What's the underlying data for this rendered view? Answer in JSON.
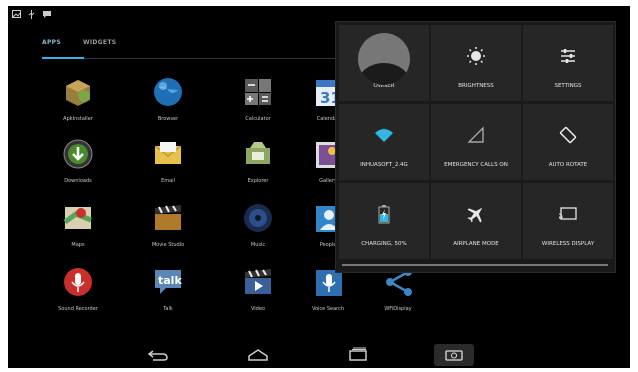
{
  "tabs": [
    "APPS",
    "WIDGETS"
  ],
  "apps": [
    {
      "label": "ApkInstaller",
      "icon": "apk-installer-icon",
      "color": "#7aa646"
    },
    {
      "label": "Browser",
      "icon": "browser-globe-icon",
      "color": "#1e6fb5"
    },
    {
      "label": "Calculator",
      "icon": "calculator-icon",
      "color": "#555555"
    },
    {
      "label": "Calendar",
      "icon": "calendar-icon",
      "color": "#3a78c3"
    },
    {
      "label": "Downloads",
      "icon": "downloads-icon",
      "color": "#4a8a2f"
    },
    {
      "label": "Email",
      "icon": "email-icon",
      "color": "#e8c14d"
    },
    {
      "label": "Explorer",
      "icon": "explorer-icon",
      "color": "#8da763"
    },
    {
      "label": "Gallery",
      "icon": "gallery-icon",
      "color": "#7b4f96"
    },
    {
      "label": "Maps",
      "icon": "maps-icon",
      "color": "#58a35a"
    },
    {
      "label": "Movie Studio",
      "icon": "movie-studio-icon",
      "color": "#b07a2a"
    },
    {
      "label": "Music",
      "icon": "music-icon",
      "color": "#2c4f8c"
    },
    {
      "label": "People",
      "icon": "people-icon",
      "color": "#2f86c8"
    },
    {
      "label": "Sound Recorder",
      "icon": "sound-recorder-icon",
      "color": "#c9302c"
    },
    {
      "label": "Talk",
      "icon": "talk-icon",
      "color": "#5c86b6"
    },
    {
      "label": "Video",
      "icon": "video-icon",
      "color": "#3a5f99"
    },
    {
      "label": "Voice Search",
      "icon": "voice-search-icon",
      "color": "#2d6fb0"
    },
    {
      "label": "WFiDisplay",
      "icon": "wifi-display-share-icon",
      "color": "#3a86c6"
    }
  ],
  "quick_settings": [
    {
      "label": "OWNER",
      "icon": "owner-avatar-icon"
    },
    {
      "label": "BRIGHTNESS",
      "icon": "brightness-icon"
    },
    {
      "label": "SETTINGS",
      "icon": "settings-sliders-icon"
    },
    {
      "label": "INHUASOFT_2.4G",
      "icon": "wifi-icon"
    },
    {
      "label": "EMERGENCY CALLS ON",
      "icon": "signal-icon"
    },
    {
      "label": "AUTO ROTATE",
      "icon": "rotate-icon"
    },
    {
      "label": "CHARGING, 50%",
      "icon": "battery-charging-icon"
    },
    {
      "label": "AIRPLANE MODE",
      "icon": "airplane-icon"
    },
    {
      "label": "WIRELESS DISPLAY",
      "icon": "wireless-display-icon"
    }
  ],
  "nav": [
    "back-icon",
    "home-icon",
    "recent-apps-icon",
    "screenshot-icon"
  ],
  "colors": {
    "accent": "#33b5e5",
    "panel": "#1a1a1a",
    "tile": "#262626"
  }
}
